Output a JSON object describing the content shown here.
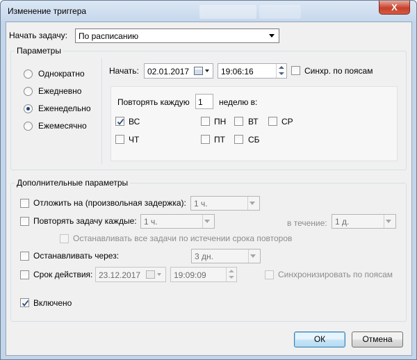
{
  "window": {
    "title": "Изменение триггера",
    "close_symbol": "X"
  },
  "begin_task": {
    "label": "Начать задачу:",
    "value": "По расписанию"
  },
  "settings": {
    "group_title": "Параметры",
    "schedule_options": [
      {
        "label": "Однократно",
        "selected": false
      },
      {
        "label": "Ежедневно",
        "selected": false
      },
      {
        "label": "Еженедельно",
        "selected": true
      },
      {
        "label": "Ежемесячно",
        "selected": false
      }
    ],
    "start_label": "Начать:",
    "start_date": "02.01.2017",
    "start_time": "19:06:16",
    "sync_timezones_label": "Синхр. по поясам",
    "sync_timezones_checked": false,
    "repeat_every_label": "Повторять каждую",
    "repeat_every_value": "1",
    "repeat_week_suffix": "неделю в:",
    "days": [
      {
        "label": "ВС",
        "checked": true
      },
      {
        "label": "ПН",
        "checked": false
      },
      {
        "label": "ВТ",
        "checked": false
      },
      {
        "label": "СР",
        "checked": false
      },
      {
        "label": "ЧТ",
        "checked": false
      },
      {
        "label": "ПТ",
        "checked": false
      },
      {
        "label": "СБ",
        "checked": false
      }
    ]
  },
  "advanced": {
    "group_title": "Дополнительные параметры",
    "delay_label": "Отложить на (произвольная задержка):",
    "delay_value": "1 ч.",
    "repeat_task_label": "Повторять задачу каждые:",
    "repeat_task_value": "1 ч.",
    "duration_label": "в течение:",
    "duration_value": "1 д.",
    "stop_all_label": "Останавливать все задачи по истечении срока повторов",
    "stop_after_label": "Останавливать через:",
    "stop_after_value": "3 дн.",
    "expire_label": "Срок действия:",
    "expire_date": "23.12.2017",
    "expire_time": "19:09:09",
    "expire_sync_label": "Синхронизировать по поясам",
    "enabled_label": "Включено",
    "enabled_checked": true
  },
  "buttons": {
    "ok": "ОК",
    "cancel": "Отмена"
  }
}
